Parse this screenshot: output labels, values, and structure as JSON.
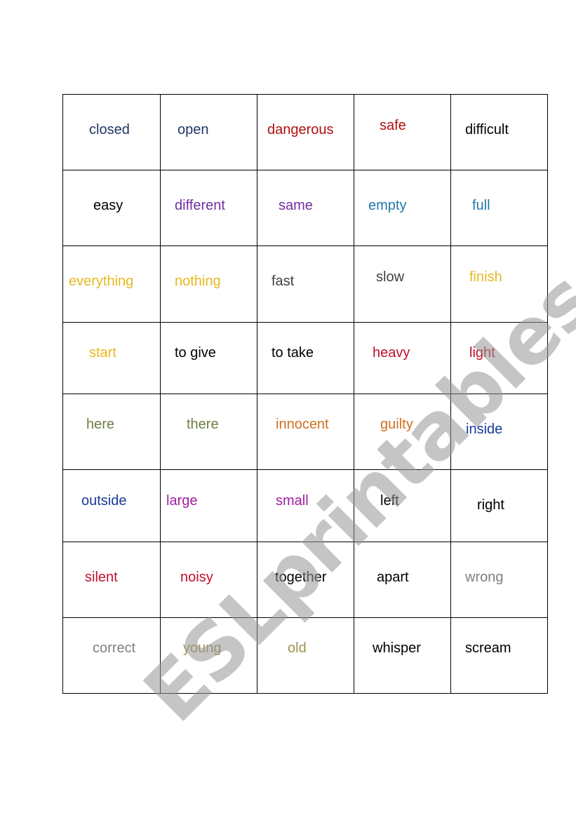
{
  "worksheet": {
    "rows": [
      [
        {
          "text": "closed",
          "color": "#1f3864"
        },
        {
          "text": "open",
          "color": "#1f3864"
        },
        {
          "text": "dangerous",
          "color": "#b01010"
        },
        {
          "text": "safe",
          "color": "#b01010"
        },
        {
          "text": "difficult",
          "color": "#000000"
        }
      ],
      [
        {
          "text": "easy",
          "color": "#000000"
        },
        {
          "text": "different",
          "color": "#7030a0"
        },
        {
          "text": "same",
          "color": "#7030a0"
        },
        {
          "text": "empty",
          "color": "#1f78a8"
        },
        {
          "text": "full",
          "color": "#1f78a8"
        }
      ],
      [
        {
          "text": "everything",
          "color": "#e8b820"
        },
        {
          "text": "nothing",
          "color": "#e8b820"
        },
        {
          "text": "fast",
          "color": "#404040"
        },
        {
          "text": "slow",
          "color": "#404040"
        },
        {
          "text": "finish",
          "color": "#e8b820"
        }
      ],
      [
        {
          "text": "start",
          "color": "#e8b820"
        },
        {
          "text": "to give",
          "color": "#000000"
        },
        {
          "text": "to take",
          "color": "#000000"
        },
        {
          "text": "heavy",
          "color": "#c0102a"
        },
        {
          "text": "light",
          "color": "#c0102a"
        }
      ],
      [
        {
          "text": "here",
          "color": "#6b8040"
        },
        {
          "text": "there",
          "color": "#6b8040"
        },
        {
          "text": "innocent",
          "color": "#d07020"
        },
        {
          "text": "guilty",
          "color": "#d07020"
        },
        {
          "text": "inside",
          "color": "#1a3a9a"
        }
      ],
      [
        {
          "text": "outside",
          "color": "#1a3a9a"
        },
        {
          "text": "large",
          "color": "#a020a0"
        },
        {
          "text": "small",
          "color": "#a020a0"
        },
        {
          "text": "left",
          "color": "#000000"
        },
        {
          "text": "right",
          "color": "#000000"
        }
      ],
      [
        {
          "text": "silent",
          "color": "#c0102a"
        },
        {
          "text": "noisy",
          "color": "#c0102a"
        },
        {
          "text": "together",
          "color": "#000000"
        },
        {
          "text": "apart",
          "color": "#000000"
        },
        {
          "text": "wrong",
          "color": "#808080"
        }
      ],
      [
        {
          "text": "correct",
          "color": "#808080"
        },
        {
          "text": "young",
          "color": "#a09050"
        },
        {
          "text": "old",
          "color": "#a09050"
        },
        {
          "text": "whisper",
          "color": "#000000"
        },
        {
          "text": "scream",
          "color": "#000000"
        }
      ]
    ]
  },
  "watermark": {
    "text": "ESLprintables.com"
  }
}
